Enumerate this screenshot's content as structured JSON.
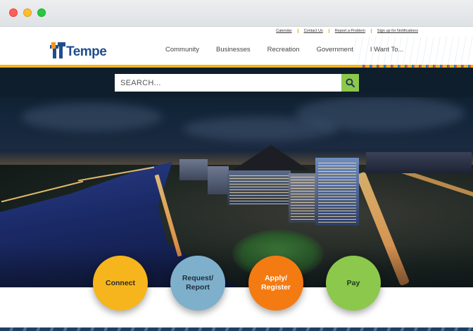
{
  "utility_links": [
    "Calendar",
    "Contact Us",
    "Report a Problem",
    "Sign up for Notifications"
  ],
  "logo": {
    "text": "Tempe"
  },
  "nav": [
    "Community",
    "Businesses",
    "Recreation",
    "Government",
    "I Want To..."
  ],
  "search": {
    "placeholder": "SEARCH...",
    "button_icon": "search-icon"
  },
  "actions": [
    {
      "label": "Connect",
      "color": "#f6b51c"
    },
    {
      "label": "Request/ Report",
      "color": "#7eb0cc"
    },
    {
      "label": "Apply/ Register",
      "color": "#f47a12"
    },
    {
      "label": "Pay",
      "color": "#8cc84b"
    }
  ],
  "colors": {
    "brand_blue": "#1f4e8c",
    "accent_gold": "#f3b41a",
    "search_green": "#8cc84b"
  }
}
